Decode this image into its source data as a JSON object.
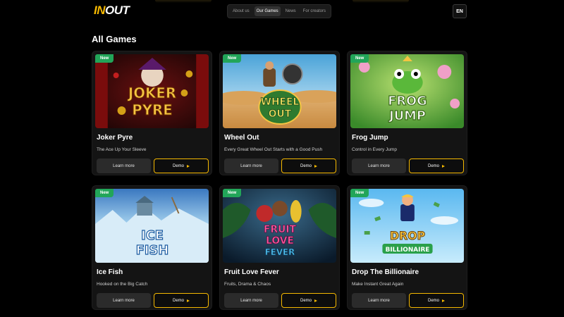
{
  "header": {
    "logo_in": "IN",
    "logo_out": "OUT",
    "nav": [
      "About us",
      "Our Games",
      "News",
      "For creators"
    ],
    "active_nav": "Our Games",
    "lang": "EN"
  },
  "section_title": "All Games",
  "games": [
    {
      "badge": "New",
      "title": "Joker Pyre",
      "subtitle": "The Ace Up Your Sleeve",
      "learn": "Learn more",
      "demo": "Demo",
      "art_text": [
        "JOKER",
        "PYRE"
      ]
    },
    {
      "badge": "New",
      "title": "Wheel Out",
      "subtitle": "Every Great Wheel Out Starts with a Good Push",
      "learn": "Learn more",
      "demo": "Demo",
      "art_text": [
        "WHEEL",
        "OUT"
      ]
    },
    {
      "badge": "New",
      "title": "Frog Jump",
      "subtitle": "Control in Every Jump",
      "learn": "Learn more",
      "demo": "Demo",
      "art_text": [
        "FROG",
        "JUMP"
      ]
    },
    {
      "badge": "New",
      "title": "Ice Fish",
      "subtitle": "Hooked on the Big Catch",
      "learn": "Learn more",
      "demo": "Demo",
      "art_text": [
        "ICE",
        "FISH"
      ]
    },
    {
      "badge": "New",
      "title": "Fruit Love Fever",
      "subtitle": "Fruits, Drama & Chaos",
      "learn": "Learn more",
      "demo": "Demo",
      "art_text": [
        "FRUIT",
        "LOVE",
        "FEVER"
      ]
    },
    {
      "badge": "New",
      "title": "Drop The Billionaire",
      "subtitle": "Make Instant Great Again",
      "learn": "Learn more",
      "demo": "Demo",
      "art_text": [
        "DROP",
        "BILLIONAIRE"
      ]
    }
  ],
  "colors": {
    "accent": "#f5b800",
    "badge": "#22a559",
    "background": "#000000"
  }
}
